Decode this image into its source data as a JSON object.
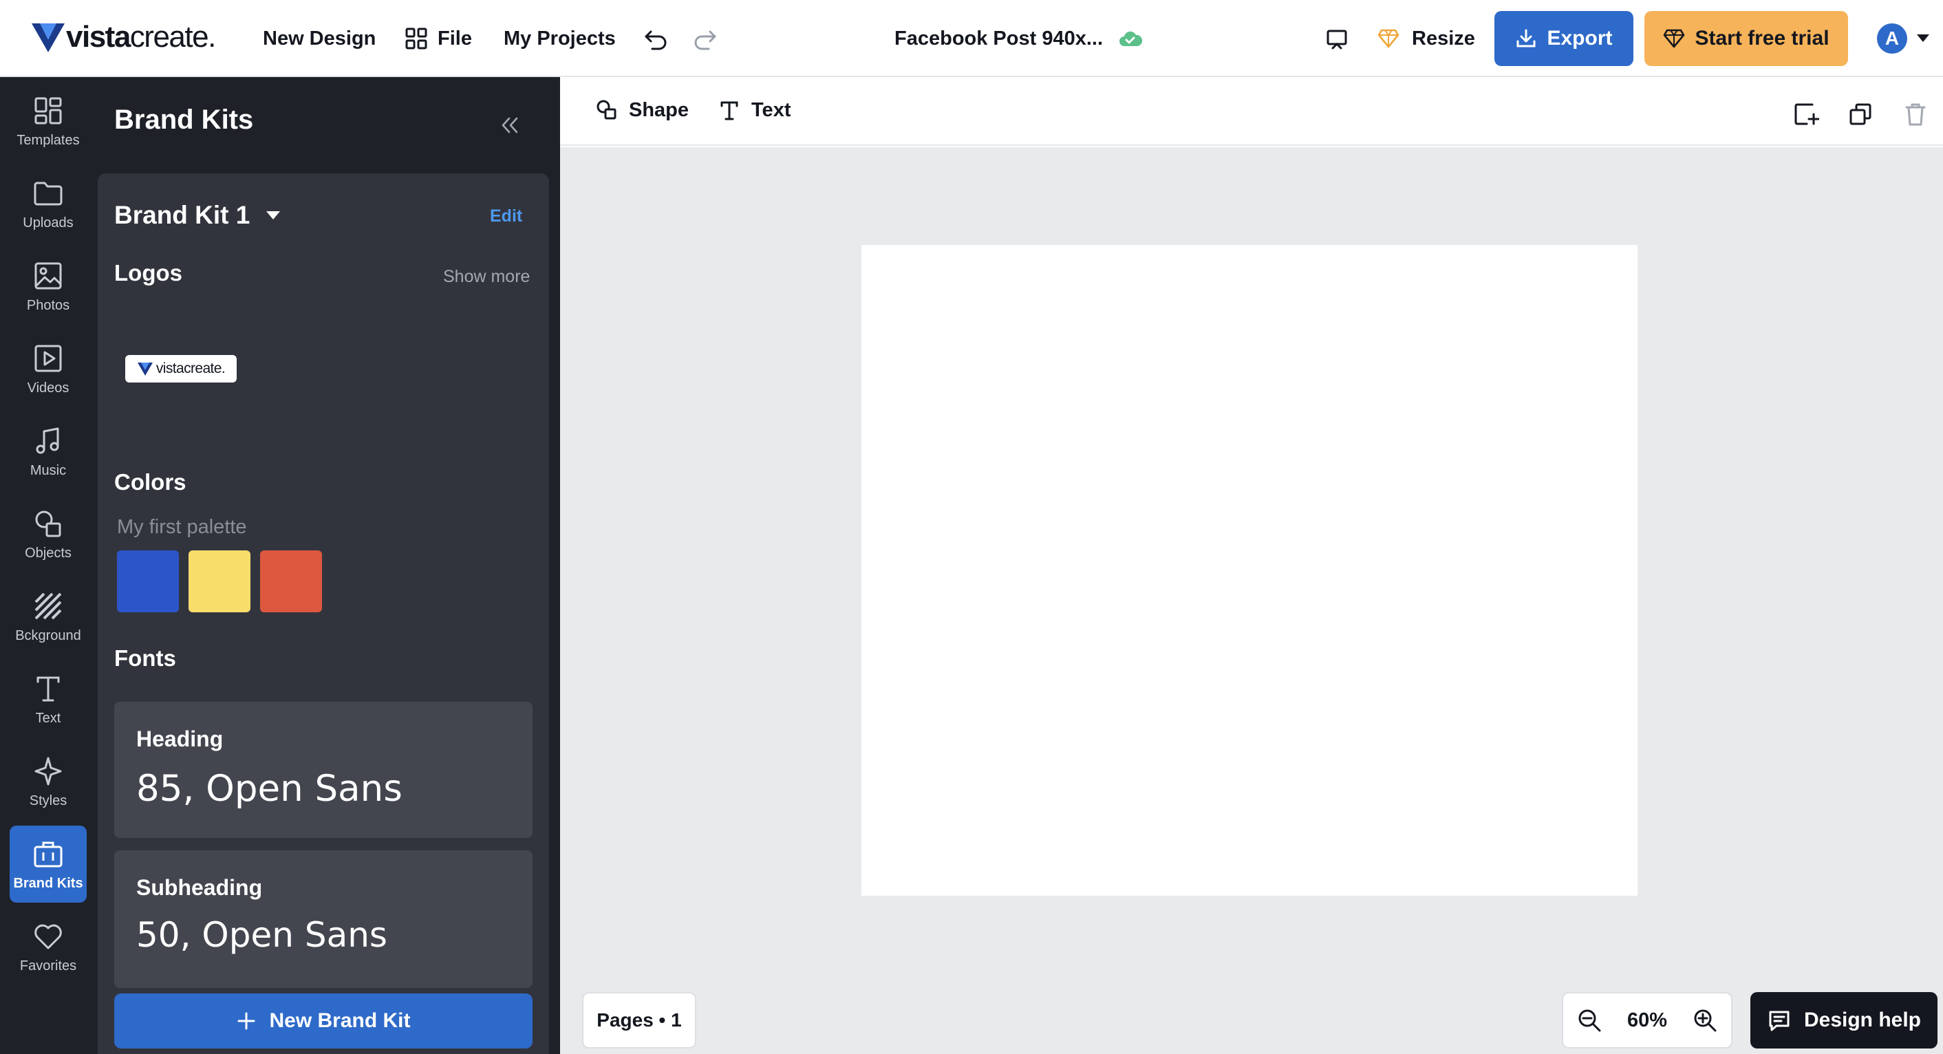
{
  "topbar": {
    "logo_text_bold": "vista",
    "logo_text_light": "create",
    "new_design": "New Design",
    "file": "File",
    "my_projects": "My Projects",
    "doc_title": "Facebook Post 940x...",
    "resize": "Resize",
    "export": "Export",
    "trial": "Start free trial",
    "avatar_initial": "A"
  },
  "rail": {
    "items": [
      {
        "label": "Templates",
        "icon": "templates-icon"
      },
      {
        "label": "Uploads",
        "icon": "folder-icon"
      },
      {
        "label": "Photos",
        "icon": "image-icon"
      },
      {
        "label": "Videos",
        "icon": "video-icon"
      },
      {
        "label": "Music",
        "icon": "music-icon"
      },
      {
        "label": "Objects",
        "icon": "shapes-icon"
      },
      {
        "label": "Bckground",
        "icon": "background-icon"
      },
      {
        "label": "Text",
        "icon": "text-icon"
      },
      {
        "label": "Styles",
        "icon": "sparkle-icon"
      },
      {
        "label": "Brand Kits",
        "icon": "briefcase-icon",
        "active": true
      },
      {
        "label": "Favorites",
        "icon": "heart-icon"
      }
    ]
  },
  "panel": {
    "title": "Brand Kits",
    "kit_name": "Brand Kit 1",
    "edit": "Edit",
    "logos_title": "Logos",
    "show_more": "Show more",
    "logo_thumb_text": "vistacreate.",
    "colors_title": "Colors",
    "palette_name": "My first palette",
    "swatches": [
      "#2c55c9",
      "#f9dd6b",
      "#dd583e"
    ],
    "fonts_title": "Fonts",
    "fonts": [
      {
        "label": "Heading",
        "spec": "85, Open Sans"
      },
      {
        "label": "Subheading",
        "spec": "50, Open Sans"
      }
    ],
    "new_kit": "New Brand Kit"
  },
  "toolbar": {
    "shape": "Shape",
    "text": "Text"
  },
  "footer": {
    "pages": "Pages • 1",
    "zoom": "60%",
    "help": "Design help"
  },
  "colors": {
    "accent": "#2e6ac9",
    "trial": "#f6b35a",
    "rail_bg": "#1f2128",
    "panel_card": "#32343d",
    "canvas_bg": "#e9eaec"
  }
}
